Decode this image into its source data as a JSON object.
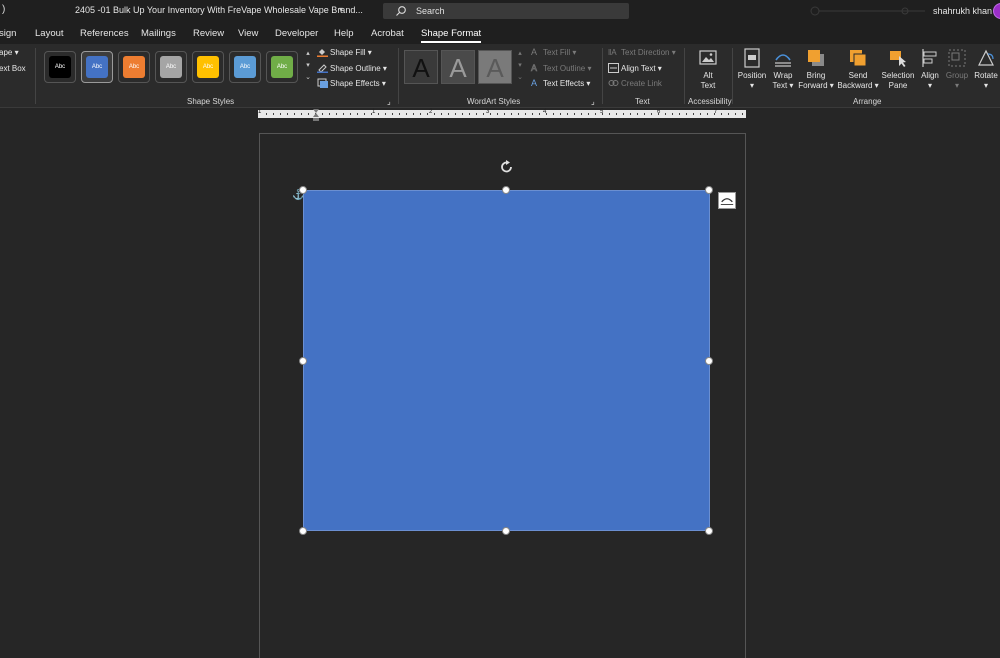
{
  "titlebar": {
    "lead": ")",
    "doc_title": "2405 -01 Bulk Up Your Inventory With FreVape Wholesale Vape Brand...",
    "search_placeholder": "Search",
    "user_name": "shahrukh khan"
  },
  "tabs": [
    "sign",
    "Layout",
    "References",
    "Mailings",
    "Review",
    "View",
    "Developer",
    "Help",
    "Acrobat",
    "Shape Format"
  ],
  "active_tab": "Shape Format",
  "insert_shapes": {
    "shape_label": "ape",
    "text_box_label": "ext Box"
  },
  "shape_styles": {
    "group_label": "Shape Styles",
    "swatch_text": "Abc",
    "swatches": [
      {
        "color": "#000000",
        "selected": false
      },
      {
        "color": "#4472c4",
        "selected": true
      },
      {
        "color": "#ed7d31",
        "selected": false
      },
      {
        "color": "#a5a5a5",
        "selected": false
      },
      {
        "color": "#ffc000",
        "selected": false
      },
      {
        "color": "#5b9bd5",
        "selected": false
      },
      {
        "color": "#70ad47",
        "selected": false
      }
    ],
    "shape_fill": "Shape Fill",
    "shape_outline": "Shape Outline",
    "shape_effects": "Shape Effects"
  },
  "wordart_styles": {
    "group_label": "WordArt Styles",
    "letter": "A",
    "text_fill": "Text Fill",
    "text_outline": "Text Outline",
    "text_effects": "Text Effects"
  },
  "text_group": {
    "group_label": "Text",
    "text_direction": "Text Direction",
    "align_text": "Align Text",
    "create_link": "Create Link"
  },
  "accessibility": {
    "group_label": "Accessibility",
    "alt_text_line1": "Alt",
    "alt_text_line2": "Text"
  },
  "arrange": {
    "group_label": "Arrange",
    "position": "Position",
    "wrap_text_1": "Wrap",
    "wrap_text_2": "Text",
    "bring_forward_1": "Bring",
    "bring_forward_2": "Forward",
    "send_backward_1": "Send",
    "send_backward_2": "Backward",
    "selection_pane_1": "Selection",
    "selection_pane_2": "Pane",
    "align": "Align",
    "group": "Group",
    "rotate": "Rotate"
  },
  "ruler": {
    "numbers": [
      "1",
      "1",
      "2",
      "3",
      "4",
      "5",
      "6",
      "7"
    ]
  },
  "shape": {
    "fill_color": "#4472c4"
  }
}
